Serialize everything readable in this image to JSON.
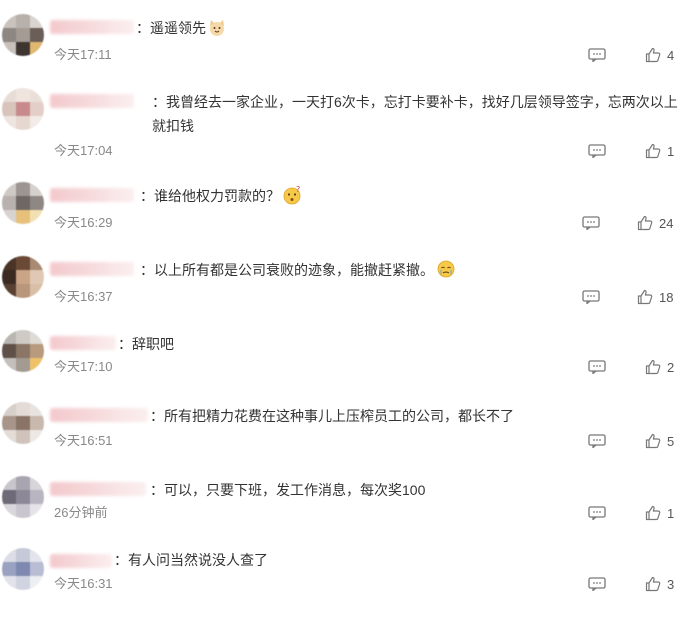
{
  "comments": [
    {
      "text": "：遥遥领先",
      "emoji": "cat-face-emoji",
      "time": "今天17:11",
      "likes": "4"
    },
    {
      "text": "：我曾经去一家企业，一天打6次卡，忘打卡要补卡，找好几层领导签字，忘两次以上就扣钱",
      "time": "今天17:04",
      "likes": "1"
    },
    {
      "text": "：谁给他权力罚款的？",
      "emoji": "thinking-face-emoji",
      "time": "今天16:29",
      "likes": "24"
    },
    {
      "text": "：以上所有都是公司衰败的迹象，能撤赶紧撤。",
      "emoji": "crying-face-emoji",
      "time": "今天16:37",
      "likes": "18"
    },
    {
      "text": "：辞职吧",
      "time": "今天17:10",
      "likes": "2"
    },
    {
      "text": "：所有把精力花费在这种事儿上压榨员工的公司，都长不了",
      "time": "今天16:51",
      "likes": "5"
    },
    {
      "text": "：可以，只要下班，发工作消息，每次奖100",
      "time": "26分钟前",
      "likes": "1"
    },
    {
      "text": "：有人问当然说没人查了",
      "time": "今天16:31",
      "likes": "3"
    }
  ],
  "colors": {
    "text": "#333333",
    "time": "#888888",
    "icon": "#777777",
    "name_blur": "#f3c9cc"
  }
}
